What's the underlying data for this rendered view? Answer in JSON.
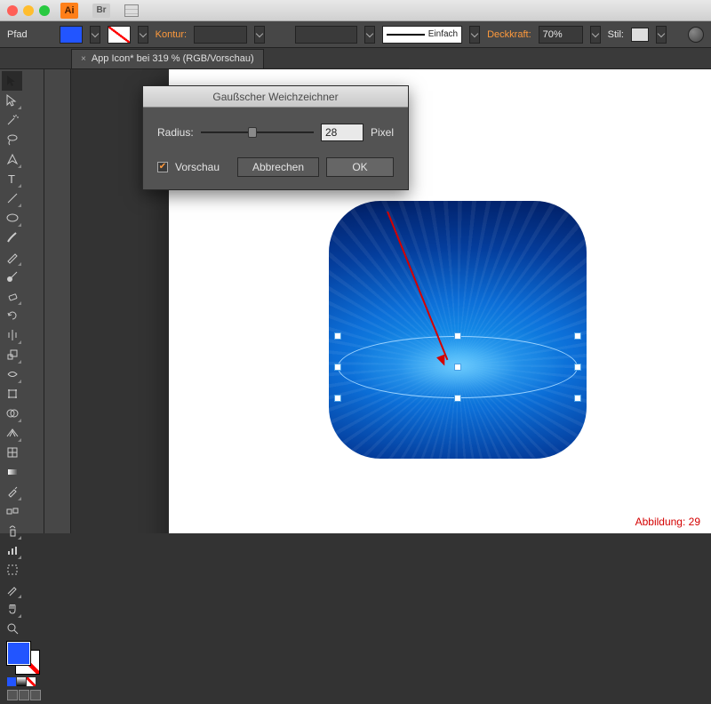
{
  "app_badge": "Ai",
  "bridge_badge": "Br",
  "controlbar": {
    "selection_label": "Pfad",
    "stroke_label": "Kontur:",
    "stroke_style_label": "Einfach",
    "opacity_label": "Deckkraft:",
    "opacity_value": "70%",
    "style_label": "Stil:"
  },
  "tab": {
    "title": "App Icon* bei 319 % (RGB/Vorschau)",
    "close": "×"
  },
  "dialog": {
    "title": "Gaußscher Weichzeichner",
    "radius_label": "Radius:",
    "radius_value": "28",
    "unit": "Pixel",
    "preview_label": "Vorschau",
    "cancel": "Abbrechen",
    "ok": "OK"
  },
  "caption": "Abbildung: 29",
  "colors": {
    "fill": "#2255ff"
  }
}
